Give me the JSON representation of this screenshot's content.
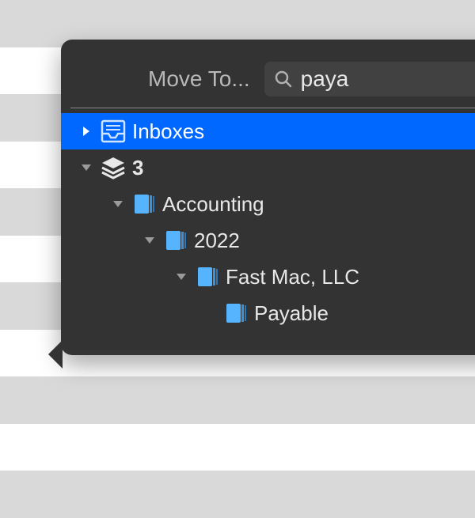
{
  "header": {
    "title": "Move To...",
    "search_value": "paya"
  },
  "tree": {
    "items": [
      {
        "label": "Inboxes",
        "bold": false
      },
      {
        "label": "3",
        "bold": true
      },
      {
        "label": "Accounting",
        "bold": false
      },
      {
        "label": "2022",
        "bold": false
      },
      {
        "label": "Fast Mac, LLC",
        "bold": false
      },
      {
        "label": "Payable",
        "bold": false
      }
    ]
  },
  "colors": {
    "selection": "#0067ff",
    "folder": "#56B4FF"
  }
}
